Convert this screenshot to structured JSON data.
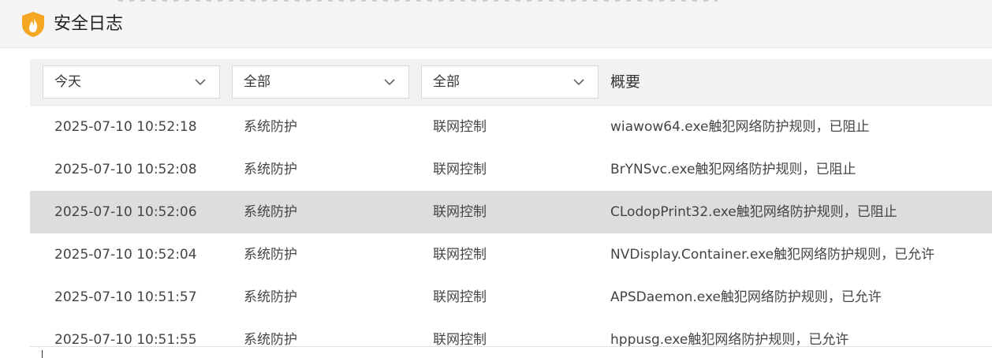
{
  "window": {
    "title": "安全日志",
    "icon": "shield-flame-icon"
  },
  "filters": {
    "date": "今天",
    "category": "全部",
    "type": "全部",
    "summary_header": "概要"
  },
  "rows": [
    {
      "time": "2025-07-10 10:52:18",
      "category": "系统防护",
      "type": "联网控制",
      "summary": "wiawow64.exe触犯网络防护规则，已阻止"
    },
    {
      "time": "2025-07-10 10:52:08",
      "category": "系统防护",
      "type": "联网控制",
      "summary": "BrYNSvc.exe触犯网络防护规则，已阻止"
    },
    {
      "time": "2025-07-10 10:52:06",
      "category": "系统防护",
      "type": "联网控制",
      "summary": "CLodopPrint32.exe触犯网络防护规则，已阻止",
      "selected": true
    },
    {
      "time": "2025-07-10 10:52:04",
      "category": "系统防护",
      "type": "联网控制",
      "summary": "NVDisplay.Container.exe触犯网络防护规则，已允许"
    },
    {
      "time": "2025-07-10 10:51:57",
      "category": "系统防护",
      "type": "联网控制",
      "summary": "APSDaemon.exe触犯网络防护规则，已允许"
    },
    {
      "time": "2025-07-10 10:51:55",
      "category": "系统防护",
      "type": "联网控制",
      "summary": "hppusg.exe触犯网络防护规则，已允许"
    }
  ],
  "colors": {
    "accent": "#f5a623",
    "selected_row": "#dddddd",
    "header_bg": "#f2f2f2"
  }
}
